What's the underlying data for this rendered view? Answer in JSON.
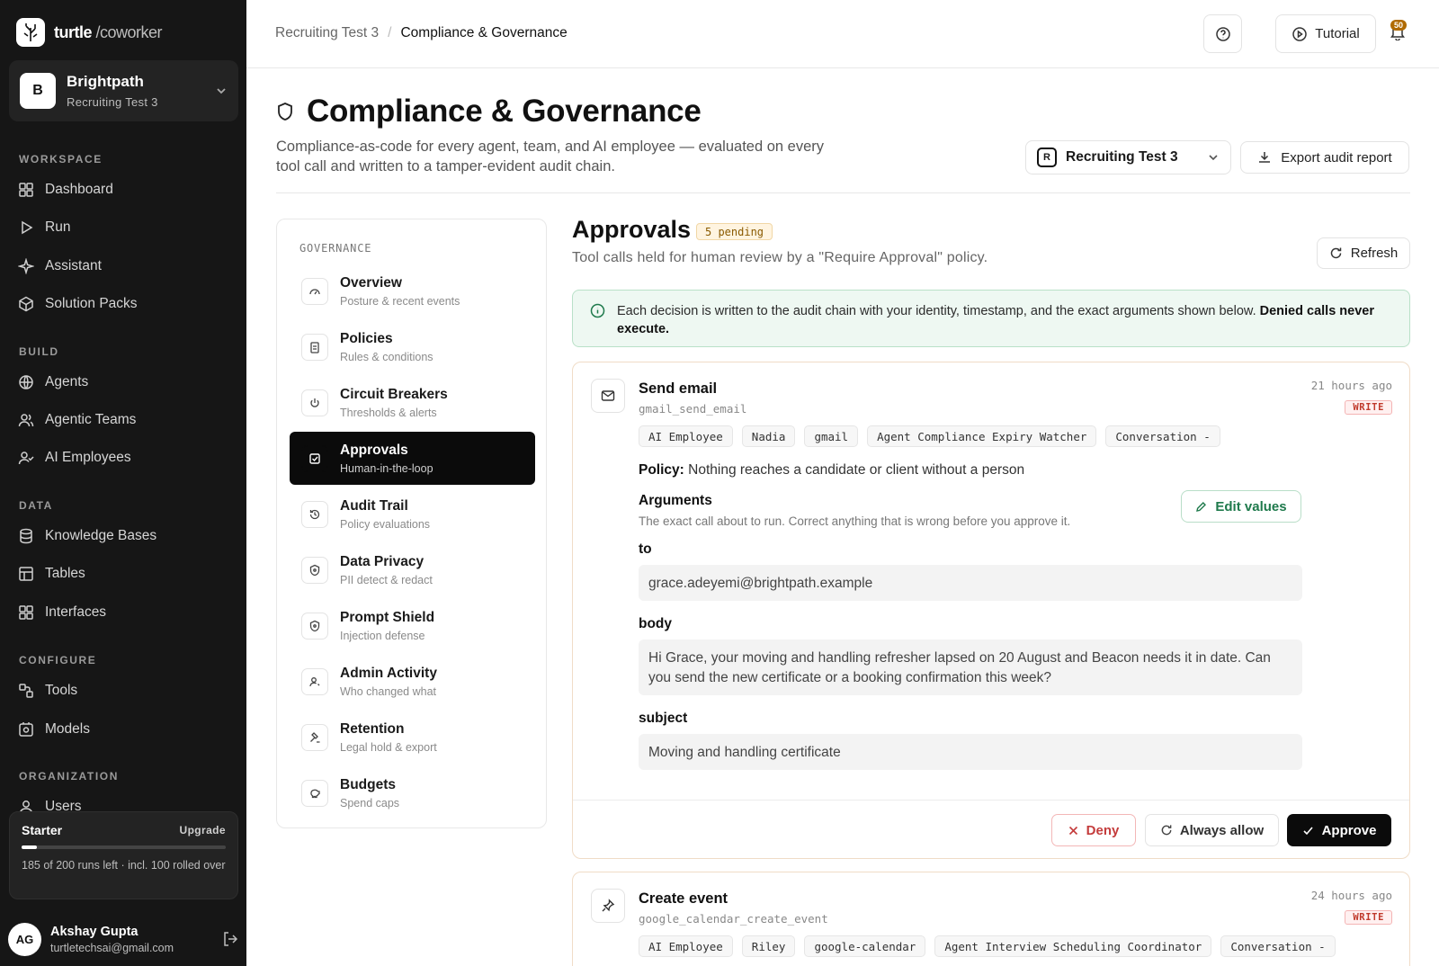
{
  "app": {
    "brand": "turtle",
    "brand_suffix": "/coworker"
  },
  "org": {
    "initial": "B",
    "name": "Brightpath",
    "project": "Recruiting Test 3"
  },
  "nav": {
    "sections": [
      "WORKSPACE",
      "BUILD",
      "DATA",
      "CONFIGURE",
      "ORGANIZATION"
    ],
    "workspace": [
      "Dashboard",
      "Run",
      "Assistant",
      "Solution Packs"
    ],
    "build": [
      "Agents",
      "Agentic Teams",
      "AI Employees"
    ],
    "data": [
      "Knowledge Bases",
      "Tables",
      "Interfaces"
    ],
    "configure": [
      "Tools",
      "Models"
    ],
    "organization": [
      "Users"
    ]
  },
  "plan": {
    "name": "Starter",
    "upgrade": "Upgrade",
    "note": "185 of 200 runs left · incl. 100 rolled over",
    "used_fraction": 0.075
  },
  "user": {
    "initials": "AG",
    "name": "Akshay Gupta",
    "email": "turtletechsai@gmail.com"
  },
  "topbar": {
    "crumb_parent": "Recruiting Test 3",
    "crumb_sep": "/",
    "crumb_current": "Compliance & Governance",
    "tutorial": "Tutorial",
    "notifications": "50"
  },
  "header": {
    "title": "Compliance & Governance",
    "description": "Compliance-as-code for every agent, team, and AI employee — evaluated on every tool call and written to a tamper-evident audit chain.",
    "project_initial": "R",
    "project": "Recruiting Test 3",
    "export": "Export audit report"
  },
  "governance": {
    "heading": "GOVERNANCE",
    "items": [
      {
        "title": "Overview",
        "sub": "Posture & recent events"
      },
      {
        "title": "Policies",
        "sub": "Rules & conditions"
      },
      {
        "title": "Circuit Breakers",
        "sub": "Thresholds & alerts"
      },
      {
        "title": "Approvals",
        "sub": "Human-in-the-loop"
      },
      {
        "title": "Audit Trail",
        "sub": "Policy evaluations"
      },
      {
        "title": "Data Privacy",
        "sub": "PII detect & redact"
      },
      {
        "title": "Prompt Shield",
        "sub": "Injection defense"
      },
      {
        "title": "Admin Activity",
        "sub": "Who changed what"
      },
      {
        "title": "Retention",
        "sub": "Legal hold & export"
      },
      {
        "title": "Budgets",
        "sub": "Spend caps"
      }
    ]
  },
  "approvals": {
    "title": "Approvals",
    "pending": "5 pending",
    "subtitle": "Tool calls held for human review by a \"Require Approval\" policy.",
    "refresh": "Refresh",
    "banner_text": "Each decision is written to the audit chain with your identity, timestamp, and the exact arguments shown below.",
    "banner_bold": "Denied calls never execute."
  },
  "cards": [
    {
      "title": "Send email",
      "code": "gmail_send_email",
      "time": "21 hours ago",
      "badge": "WRITE",
      "tags": [
        "AI Employee",
        "Nadia",
        "gmail",
        "Agent Compliance Expiry Watcher",
        "Conversation -"
      ],
      "policy_label": "Policy:",
      "policy": "Nothing reaches a candidate or client without a person",
      "args_title": "Arguments",
      "args_sub": "The exact call about to run. Correct anything that is wrong before you approve it.",
      "edit": "Edit values",
      "fields": [
        {
          "label": "to",
          "value": "grace.adeyemi@brightpath.example"
        },
        {
          "label": "body",
          "value": "Hi Grace, your moving and handling refresher lapsed on 20 August and Beacon needs it in date. Can you send the new certificate or a booking confirmation this week?"
        },
        {
          "label": "subject",
          "value": "Moving and handling certificate"
        }
      ],
      "deny": "Deny",
      "always_allow": "Always allow",
      "approve": "Approve"
    },
    {
      "title": "Create event",
      "code": "google_calendar_create_event",
      "time": "24 hours ago",
      "badge": "WRITE",
      "tags": [
        "AI Employee",
        "Riley",
        "google-calendar",
        "Agent Interview Scheduling Coordinator",
        "Conversation -"
      ]
    }
  ]
}
